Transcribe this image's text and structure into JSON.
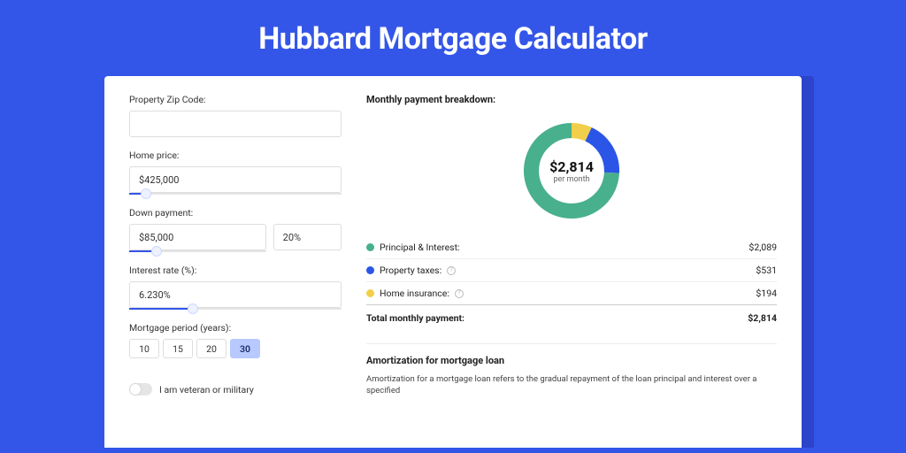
{
  "title": "Hubbard Mortgage Calculator",
  "form": {
    "zip_label": "Property Zip Code:",
    "zip_value": "",
    "home_price_label": "Home price:",
    "home_price_value": "$425,000",
    "home_price_slider_pct": 8,
    "down_payment_label": "Down payment:",
    "down_payment_amount": "$85,000",
    "down_payment_amount_slider_pct": 20,
    "down_payment_pct": "20%",
    "interest_label": "Interest rate (%):",
    "interest_value": "6.230%",
    "interest_slider_pct": 30,
    "period_label": "Mortgage period (years):",
    "period_options": [
      "10",
      "15",
      "20",
      "30"
    ],
    "period_selected_index": 3,
    "veteran_label": "I am veteran or military",
    "veteran_on": false
  },
  "breakdown": {
    "title": "Monthly payment breakdown:",
    "center_amount": "$2,814",
    "center_sub": "per month",
    "rows": [
      {
        "label": "Principal & Interest:",
        "value": "$2,089",
        "color": "#48b08c",
        "info": false
      },
      {
        "label": "Property taxes:",
        "value": "$531",
        "color": "#2b55e6",
        "info": true
      },
      {
        "label": "Home insurance:",
        "value": "$194",
        "color": "#f2cf4a",
        "info": true
      }
    ],
    "total_label": "Total monthly payment:",
    "total_value": "$2,814"
  },
  "amortization": {
    "title": "Amortization for mortgage loan",
    "text": "Amortization for a mortgage loan refers to the gradual repayment of the loan principal and interest over a specified"
  },
  "chart_data": {
    "type": "pie",
    "title": "Monthly payment breakdown",
    "series": [
      {
        "name": "Principal & Interest",
        "value": 2089,
        "color": "#48b08c"
      },
      {
        "name": "Property taxes",
        "value": 531,
        "color": "#2b55e6"
      },
      {
        "name": "Home insurance",
        "value": 194,
        "color": "#f2cf4a"
      }
    ],
    "total": 2814,
    "center_label": "$2,814 per month"
  }
}
